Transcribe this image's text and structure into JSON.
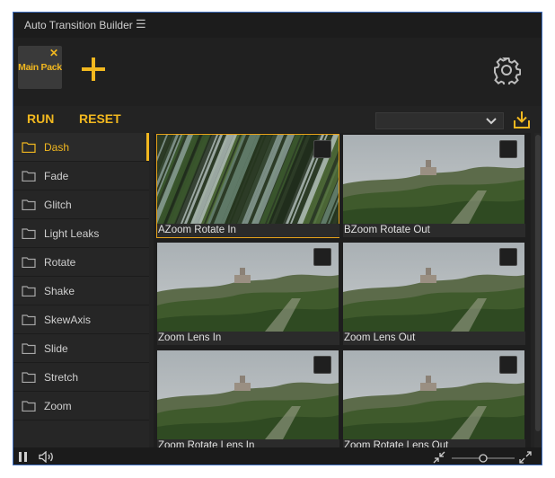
{
  "window": {
    "title": "Auto Transition Builder",
    "menu_icon": "hamburger-icon"
  },
  "pack": {
    "label": "Main Pack",
    "close_glyph": "✕",
    "add_icon": "plus-icon",
    "settings_icon": "gear-icon"
  },
  "toolbar": {
    "run_label": "RUN",
    "reset_label": "RESET",
    "dropdown_value": "",
    "import_icon": "import-icon"
  },
  "sidebar": {
    "active_index": 0,
    "items": [
      {
        "label": "Dash"
      },
      {
        "label": "Fade"
      },
      {
        "label": "Glitch"
      },
      {
        "label": "Light Leaks"
      },
      {
        "label": "Rotate"
      },
      {
        "label": "Shake"
      },
      {
        "label": "SkewAxis"
      },
      {
        "label": "Slide"
      },
      {
        "label": "Stretch"
      },
      {
        "label": "Zoom"
      }
    ]
  },
  "grid": {
    "items": [
      {
        "label": "AZoom Rotate In",
        "selected": true,
        "style": "streak"
      },
      {
        "label": "BZoom Rotate Out",
        "selected": false,
        "style": "landscape"
      },
      {
        "label": "Zoom Lens In",
        "selected": false,
        "style": "landscape"
      },
      {
        "label": "Zoom Lens Out",
        "selected": false,
        "style": "landscape"
      },
      {
        "label": "Zoom Rotate Lens In",
        "selected": false,
        "style": "landscape"
      },
      {
        "label": "Zoom Rotate Lens Out",
        "selected": false,
        "style": "landscape"
      }
    ]
  },
  "bottom": {
    "pause_icon": "pause-icon",
    "volume_icon": "volume-icon",
    "shrink_icon": "shrink-icon",
    "expand_icon": "expand-icon",
    "zoom_slider_value": 0.5
  },
  "colors": {
    "accent": "#f2b81f",
    "background": "#232323",
    "selection": "#e7a21a"
  }
}
